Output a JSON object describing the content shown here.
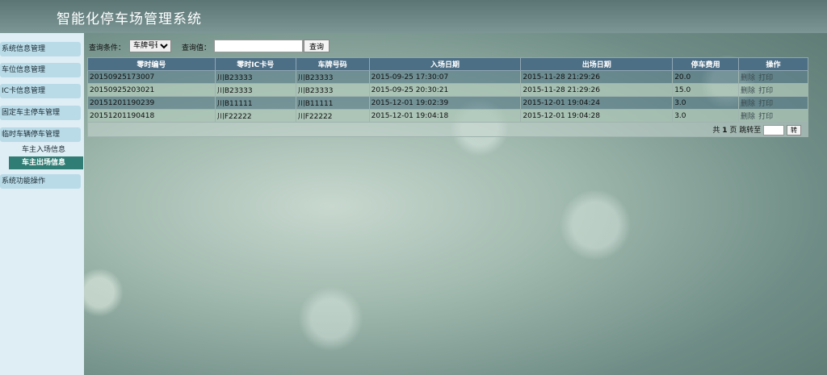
{
  "app": {
    "title": "智能化停车场管理系统"
  },
  "sidebar": {
    "items": [
      {
        "label": "系统信息管理"
      },
      {
        "label": "车位信息管理"
      },
      {
        "label": "IC卡信息管理"
      },
      {
        "label": "固定车主停车管理"
      },
      {
        "label": "临时车辆停车管理"
      },
      {
        "label": "系统功能操作"
      }
    ],
    "sub_items": [
      {
        "label": "车主入场信息"
      },
      {
        "label": "车主出场信息"
      }
    ]
  },
  "query": {
    "condition_label": "查询条件：",
    "condition_selected": "车牌号码",
    "value_label": "查询值：",
    "value": "",
    "button_label": "查询"
  },
  "table": {
    "headers": [
      "零时编号",
      "零时IC卡号",
      "车牌号码",
      "入场日期",
      "出场日期",
      "停车费用",
      "操作"
    ],
    "rows": [
      [
        "20150925173007",
        "川B23333",
        "川B23333",
        "2015-09-25 17:30:07",
        "2015-11-28 21:29:26",
        "20.0"
      ],
      [
        "20150925203021",
        "川B23333",
        "川B23333",
        "2015-09-25 20:30:21",
        "2015-11-28 21:29:26",
        "15.0"
      ],
      [
        "20151201190239",
        "川B11111",
        "川B11111",
        "2015-12-01 19:02:39",
        "2015-12-01 19:04:24",
        "3.0"
      ],
      [
        "20151201190418",
        "川F22222",
        "川F22222",
        "2015-12-01 19:04:18",
        "2015-12-01 19:04:28",
        "3.0"
      ]
    ],
    "actions": {
      "delete": "删除",
      "print": "打印"
    }
  },
  "pager": {
    "prefix": "共",
    "total_pages": "1",
    "suffix": "页 跳转至",
    "jump_value": "",
    "go_label": "转"
  }
}
